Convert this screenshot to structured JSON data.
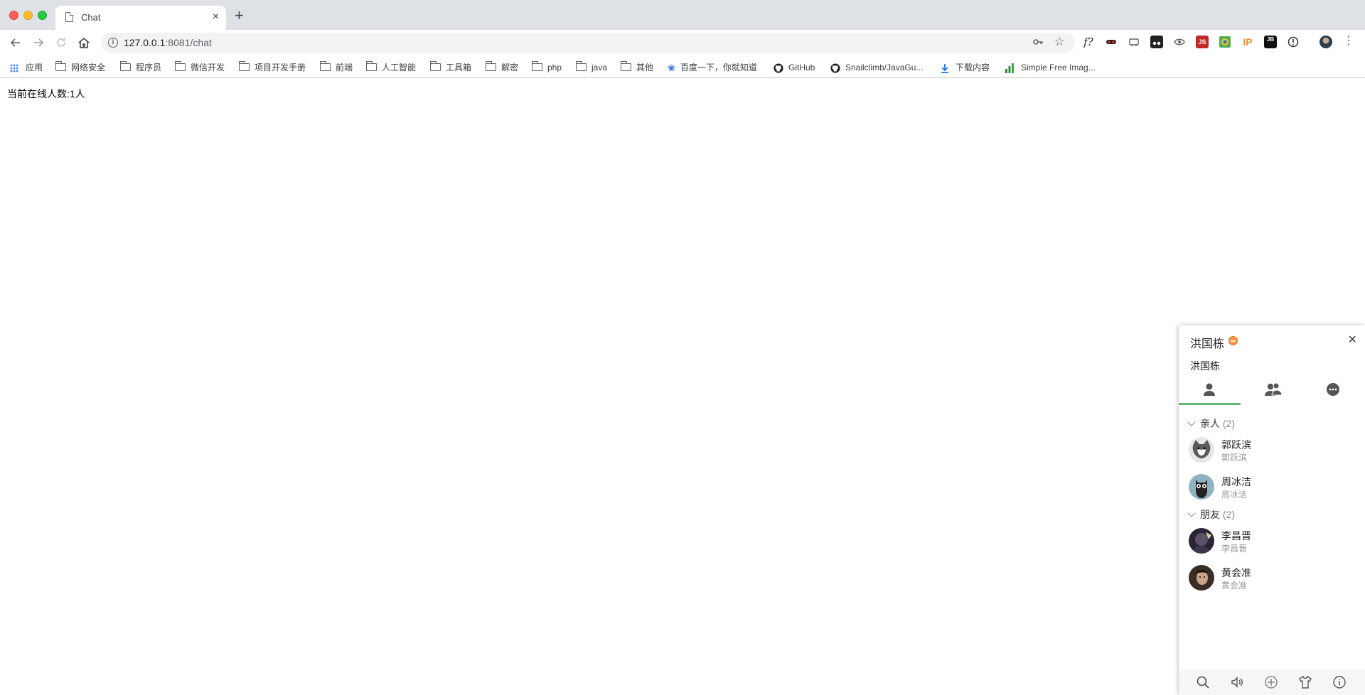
{
  "browser": {
    "tab_title": "Chat",
    "tab_close": "×",
    "new_tab": "+",
    "url_host": "127.0.0.1",
    "url_path": ":8081/chat",
    "info_glyph": "i"
  },
  "bookmarks": [
    {
      "label": "应用",
      "icon": "apps-grid-icon"
    },
    {
      "label": "网络安全",
      "icon": "folder-icon"
    },
    {
      "label": "程序员",
      "icon": "folder-icon"
    },
    {
      "label": "微信开发",
      "icon": "folder-icon"
    },
    {
      "label": "项目开发手册",
      "icon": "folder-icon"
    },
    {
      "label": "前端",
      "icon": "folder-icon"
    },
    {
      "label": "人工智能",
      "icon": "folder-icon"
    },
    {
      "label": "工具箱",
      "icon": "folder-icon"
    },
    {
      "label": "解密",
      "icon": "folder-icon"
    },
    {
      "label": "php",
      "icon": "folder-icon"
    },
    {
      "label": "java",
      "icon": "folder-icon"
    },
    {
      "label": "其他",
      "icon": "folder-icon"
    },
    {
      "label": "百度一下，你就知道",
      "icon": "baidu-paw-icon"
    },
    {
      "label": "GitHub",
      "icon": "github-icon"
    },
    {
      "label": "Snailclimb/JavaGu...",
      "icon": "github-icon"
    },
    {
      "label": "下载内容",
      "icon": "download-icon"
    },
    {
      "label": "Simple Free Imag...",
      "icon": "bar-chart-icon"
    }
  ],
  "page": {
    "online_text": "当前在线人数:1人"
  },
  "chat": {
    "username": "洪国栋",
    "sign": "洪国栋",
    "close": "×",
    "groups": [
      {
        "name": "亲人",
        "count": "(2)",
        "friends": [
          {
            "name": "郭跃滨",
            "sign": "郭跃滨"
          },
          {
            "name": "周冰洁",
            "sign": "周冰洁"
          }
        ]
      },
      {
        "name": "朋友",
        "count": "(2)",
        "friends": [
          {
            "name": "李昌晋",
            "sign": "李昌晋"
          },
          {
            "name": "黄会准",
            "sign": "黄会准"
          }
        ]
      }
    ]
  },
  "colors": {
    "tab_active_underline": "#5fb878",
    "status_away": "#ff9447"
  }
}
